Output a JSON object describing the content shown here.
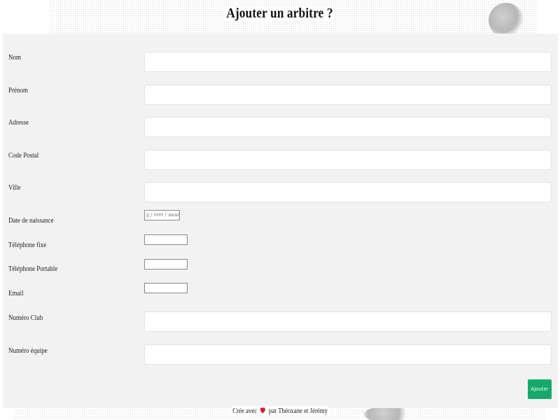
{
  "page": {
    "title": "Ajouter un arbitre ?"
  },
  "form": {
    "fields": {
      "nom": {
        "label": "Nom",
        "value": ""
      },
      "prenom": {
        "label": "Prénom",
        "value": ""
      },
      "adresse": {
        "label": "Adresse",
        "value": ""
      },
      "code_postal": {
        "label": "Code Postal",
        "value": ""
      },
      "ville": {
        "label": "Ville",
        "value": ""
      },
      "date_naissance": {
        "label": "Date de naissance",
        "placeholder": "jj / mm / aaaa"
      },
      "telephone_fixe": {
        "label": "Téléphone fixe",
        "value": ""
      },
      "telephone_portable": {
        "label": "Téléphone Portable",
        "value": ""
      },
      "email": {
        "label": "Email",
        "value": ""
      },
      "numero_club": {
        "label": "Numéro Club",
        "value": ""
      },
      "numero_equipe": {
        "label": "Numéro équipe",
        "value": ""
      }
    },
    "submit_label": "Ajouter"
  },
  "footer": {
    "prefix": "Crée avec",
    "suffix": "par Théoxane et Jérémy",
    "heart_icon": "heart-icon",
    "heart_color": "#d21f2d"
  },
  "colors": {
    "panel_bg": "#f2f2f2",
    "submit_bg": "#17a96a"
  }
}
